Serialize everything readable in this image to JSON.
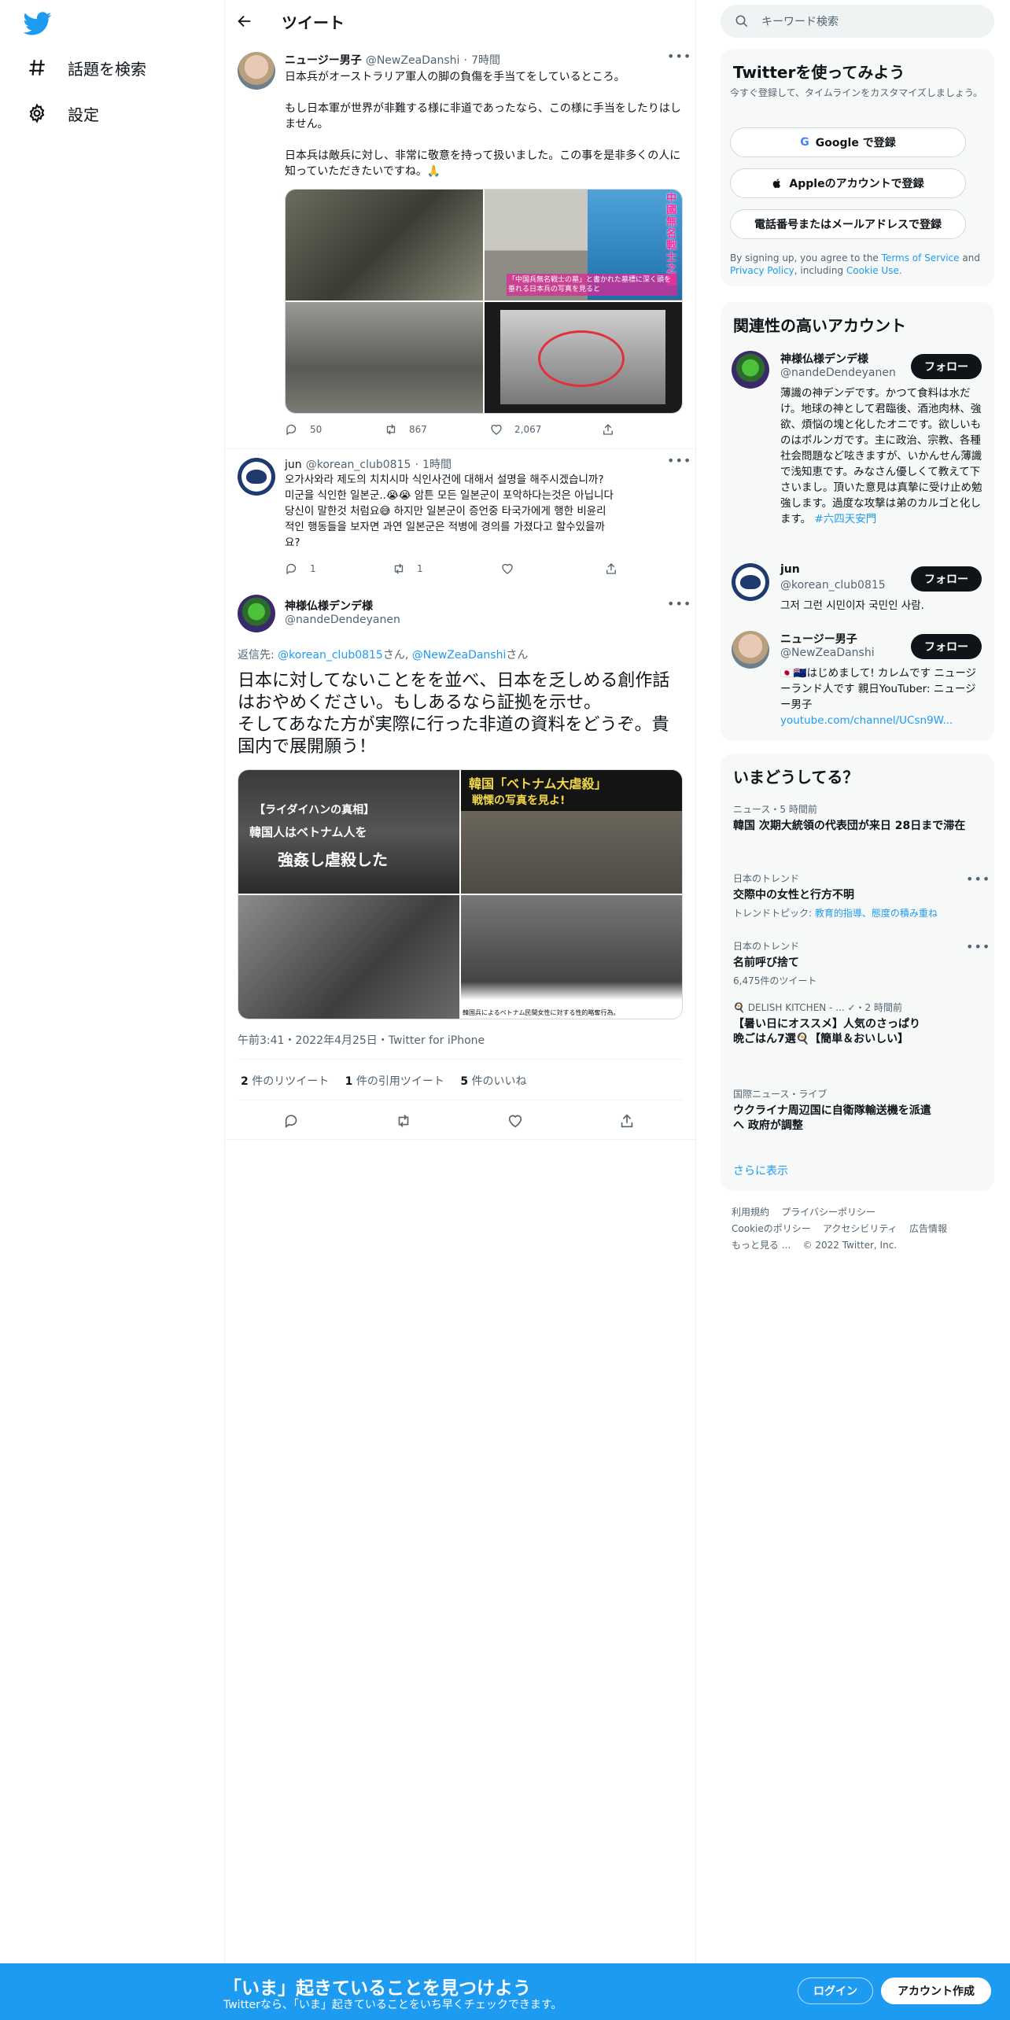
{
  "nav": {
    "items": [
      {
        "label": "話題を検索",
        "icon": "hashtag-icon"
      },
      {
        "label": "設定",
        "icon": "gear-icon"
      }
    ]
  },
  "header": {
    "title": "ツイート"
  },
  "tweets": [
    {
      "name": "ニュージー男子",
      "handle": "@NewZeaDanshi",
      "time": "7時間",
      "text": "日本兵がオーストラリア軍人の脚の負傷を手当てをしているところ。\n\nもし日本軍が世界が非難する様に非道であったなら、この様に手当をしたりはしません。\n\n日本兵は敵兵に対し、非常に敬意を持って扱いました。この事を是非多くの人に知っていただきたいですね。🙏",
      "media_captions": [
        "中國無名戰士之墓",
        "「中国兵無名戦士の墓」と書かれた墓標に深く頭を垂れる日本兵の写真を見ると"
      ],
      "replies": "50",
      "retweets": "867",
      "likes": "2,067"
    },
    {
      "name": "jun",
      "handle": "@korean_club0815",
      "time": "1時間",
      "text": "오가사와라 제도의 치치시마 식인사건에 대해서 설명을 해주시겠습니까?\n미군을 식인한 일본군..😭😭 암튼 모든 일본군이 포악하다는것은 아닙니다\n당신이 말한것 처럼요😅 하지만 일본군이 증언중 타국가에게 행한 비윤리\n적인 행동들을 보자면 과연 일본군은 적병에 경의를 가졌다고 할수있을까\n요?",
      "replies": "1",
      "retweets": "1",
      "likes": ""
    }
  ],
  "main_tweet": {
    "name": "神様仏様デンデ様",
    "handle": "@nandeDendeyanen",
    "reply_prefix": "返信先:",
    "reply_to_1": "@korean_club0815",
    "reply_to_2": "@NewZeaDanshi",
    "reply_suffix_1": "さん,",
    "reply_suffix_2": "さん",
    "text": "日本に対してないことをを並べ、日本を乏しめる創作話はおやめください。もしあるなら証拠を示せ。\nそしてあなた方が実際に行った非道の資料をどうぞ。貴国内で展開願う！",
    "media_captions": [
      "【ライダイハンの真相】",
      "韓国人はベトナム人を",
      "強姦し虐殺した",
      "韓国「ベトナム大虐殺」",
      "戦慄の写真を見よ!",
      "韓国兵によるベトナム民間女性に対する性的略奪行為。"
    ],
    "timestamp": "午前3:41・2022年4月25日・Twitter for iPhone",
    "retweets_count": "2",
    "retweets_label": "件のリツイート",
    "quotes_count": "1",
    "quotes_label": "件の引用ツイート",
    "likes_count": "5",
    "likes_label": "件のいいね"
  },
  "search": {
    "placeholder": "キーワード検索"
  },
  "signup": {
    "title": "Twitterを使ってみよう",
    "subtitle": "今すぐ登録して、タイムラインをカスタマイズしましょう。",
    "google": "Google で登録",
    "apple": "Appleのアカウントで登録",
    "phone": "電話番号またはメールアドレスで登録",
    "terms_1": "By signing up, you agree to the",
    "terms_link_1": "Terms of Service",
    "terms_2": "and",
    "terms_link_2": "Privacy Policy",
    "terms_3": ", including",
    "terms_link_3": "Cookie Use."
  },
  "related": {
    "title": "関連性の高いアカウント",
    "follow_label": "フォロー",
    "accounts": [
      {
        "name": "神様仏様デンデ様",
        "handle": "@nandeDendeyanen",
        "bio": "薄識の神デンデです。かつて食料は水だけ。地球の神として君臨後、酒池肉林、強欲、煩悩の塊と化したオニです。欲しいものはポルンガです。主に政治、宗教、各種社会問題など呟きますが、いかんせん薄識で浅知恵です。みなさん優しくて教えて下さいまし。頂いた意見は真摯に受け止め勉強します。過度な攻撃は弟のカルゴと化します。",
        "bio_link": "#六四天安門"
      },
      {
        "name": "jun",
        "handle": "@korean_club0815",
        "bio": "그저 그런 시민이자 국민인 사람."
      },
      {
        "name": "ニュージー男子",
        "handle": "@NewZeaDanshi",
        "bio": "🇯🇵🇳🇿はじめまして! カレムです ニュージーランド人です 親日YouTuber: ニュージー男子",
        "bio_link": "youtube.com/channel/UCsn9W..."
      }
    ]
  },
  "trends": {
    "title": "いまどうしてる？",
    "items": [
      {
        "context": "ニュース・5 時間前",
        "title": "韓国 次期大統領の代表団が来日 28日まで滞在"
      },
      {
        "context": "日本のトレンド",
        "title": "交際中の女性と行方不明",
        "extra_prefix": "トレンドトピック:",
        "extra": "教育的指導、態度の積み重ね"
      },
      {
        "context": "日本のトレンド",
        "title": "名前呼び捨て",
        "extra_prefix": "6,475件のツイート"
      },
      {
        "context": "🍳 DELISH KITCHEN - ... ✓・2 時間前",
        "title": "【暑い日にオススメ】人気のさっぱり晩ごはん7選🍳【簡単＆おいしい】"
      },
      {
        "context": "国際ニュース・ライブ",
        "title": "ウクライナ周辺国に自衛隊輸送機を派遣へ 政府が調整"
      }
    ],
    "show_more": "さらに表示"
  },
  "footer": {
    "links": [
      "利用規約",
      "プライバシーポリシー",
      "Cookieのポリシー",
      "アクセシビリティ",
      "広告情報",
      "もっと見る ...",
      "© 2022 Twitter, Inc."
    ]
  },
  "bottombar": {
    "title": "「いま」起きていることを見つけよう",
    "subtitle": "Twitterなら、「いま」起きていることをいち早くチェックできます。",
    "login": "ログイン",
    "signup": "アカウント作成"
  },
  "colors": {
    "brand": "#1d9bf0",
    "text": "#0f1419",
    "muted": "#536471",
    "border": "#eff3f4"
  }
}
